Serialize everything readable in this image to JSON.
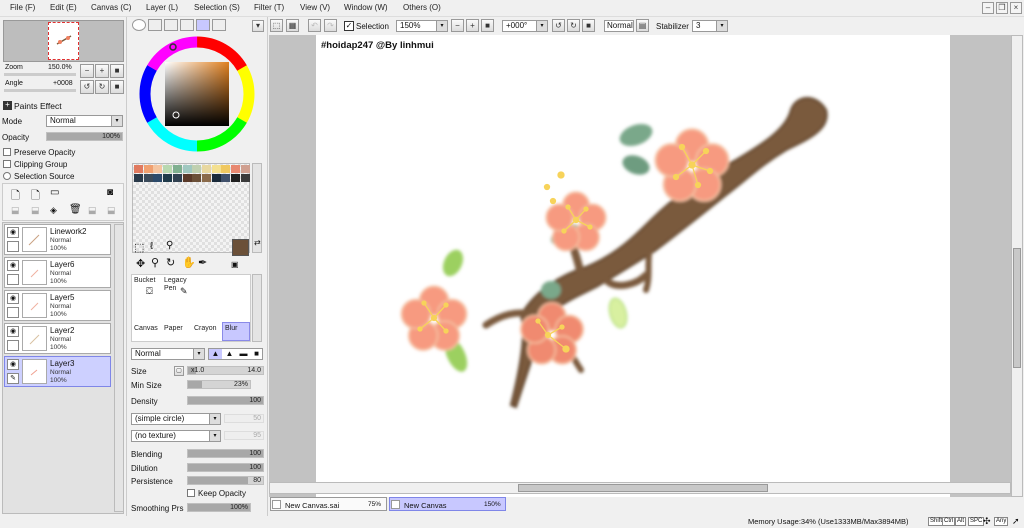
{
  "menu": [
    "File (F)",
    "Edit (E)",
    "Canvas (C)",
    "Layer (L)",
    "Selection (S)",
    "Filter (T)",
    "View (V)",
    "Window (W)",
    "Others (O)"
  ],
  "navigator": {
    "zoom_label": "Zoom",
    "zoom_value": "150.0%",
    "angle_label": "Angle",
    "angle_value": "+0008"
  },
  "paints_effect": {
    "header": "Paints Effect",
    "mode_label": "Mode",
    "mode_value": "Normal",
    "opacity_label": "Opacity",
    "opacity_value": "100%"
  },
  "options": {
    "preserve_opacity": "Preserve Opacity",
    "clipping_group": "Clipping Group",
    "selection_source": "Selection Source"
  },
  "layers": [
    {
      "name": "Linework2",
      "mode": "Normal",
      "opacity": "100%"
    },
    {
      "name": "Layer6",
      "mode": "Normal",
      "opacity": "100%"
    },
    {
      "name": "Layer5",
      "mode": "Normal",
      "opacity": "100%"
    },
    {
      "name": "Layer2",
      "mode": "Normal",
      "opacity": "100%"
    },
    {
      "name": "Layer3",
      "mode": "Normal",
      "opacity": "100%"
    }
  ],
  "tools": {
    "bucket": "Bucket",
    "legacy_pen": "Legacy Pen",
    "canvas_tool": "Canvas",
    "paper_tool": "Paper",
    "crayon": "Crayon",
    "blur": "Blur",
    "blend_mode": "Normal"
  },
  "brush": {
    "size_label": "Size",
    "size_mult": "x1.0",
    "size_value": "14.0",
    "size_fill": 0.1,
    "min_size_label": "Min Size",
    "min_size_value": "23%",
    "min_size_fill": 0.23,
    "density_label": "Density",
    "density_value": "100",
    "density_fill": 1.0,
    "shape": "(simple circle)",
    "shape_value": "50",
    "texture": "(no texture)",
    "texture_value": "95",
    "blending_label": "Blending",
    "blending_value": "100",
    "blending_fill": 1.0,
    "dilution_label": "Dilution",
    "dilution_value": "100",
    "dilution_fill": 1.0,
    "persistence_label": "Persistence",
    "persistence_value": "80",
    "persistence_fill": 0.8,
    "keep_opacity": "Keep Opacity",
    "smoothing_label": "Smoothing Prs",
    "smoothing_value": "100%",
    "smoothing_fill": 1.0
  },
  "toolbar": {
    "selection_label": "Selection",
    "zoom_value": "150%",
    "angle_value": "+000°",
    "blend_value": "Normal",
    "stabilizer_label": "Stabilizer",
    "stabilizer_value": "3"
  },
  "canvas": {
    "watermark": "#hoidap247 @By linhmui"
  },
  "doc_tabs": [
    {
      "name": "New Canvas.sai",
      "zoom": "75%"
    },
    {
      "name": "New Canvas",
      "zoom": "150%"
    }
  ],
  "status": {
    "memory": "Memory Usage:34% (Use1333MB/Max3894MB)",
    "keys": [
      "Shift",
      "Ctrl",
      "Alt",
      "SPC",
      "Any"
    ]
  },
  "colors": {
    "main_color": "#6b5038",
    "accent_tab": "#c8c8ff"
  },
  "palette": [
    "#e07a5f",
    "#f0a070",
    "#f5c5a0",
    "#b8d8b0",
    "#80b090",
    "#a0c8c0",
    "#c0d0b0",
    "#e8d8a0",
    "#f4e090",
    "#f0c860",
    "#e88870",
    "#d0a090",
    "#2a3a4a",
    "#3a4a5a",
    "#2c4a6a",
    "#1f3a4a",
    "#304050",
    "#5a3a2a",
    "#6b5038",
    "#8a6a4a",
    "#1a2a3a",
    "#40506a",
    "#202020",
    "#3a3a3a"
  ]
}
